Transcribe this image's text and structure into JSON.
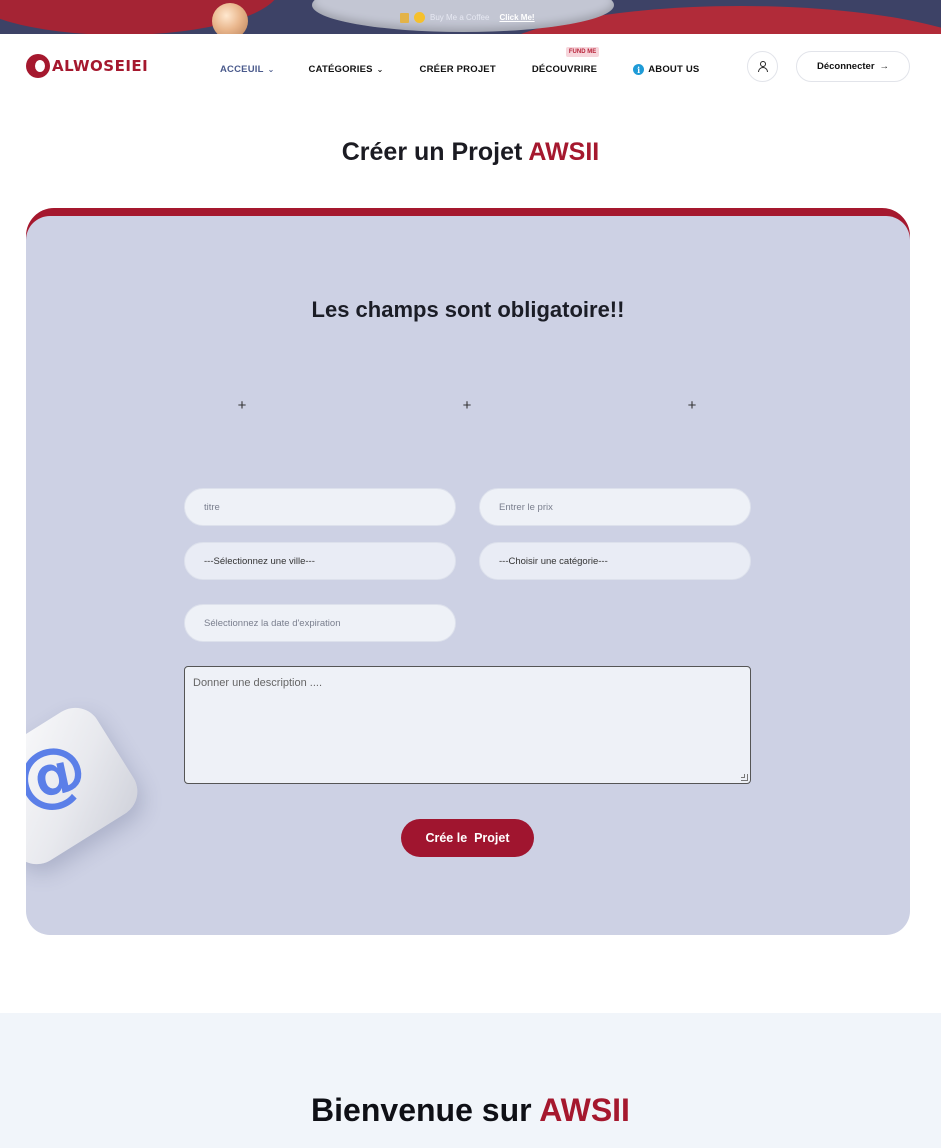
{
  "promo": {
    "text": "Buy Me a Coffee",
    "link": "Click Me!"
  },
  "brand": {
    "logo_text": "ALWOSEIEI"
  },
  "nav": {
    "items": [
      {
        "label": "ACCEUIL",
        "dropdown": true,
        "active": true
      },
      {
        "label": "CATÉGORIES",
        "dropdown": true
      },
      {
        "label": "CRÉER PROJET"
      },
      {
        "label": "DÉCOUVRIRE",
        "badge": "FUND ME"
      },
      {
        "label": "ABOUT US",
        "icon": "info-icon"
      }
    ],
    "user_icon": "user-icon",
    "logout_label": "Déconnecter"
  },
  "page": {
    "title_prefix": "Créer un Projet",
    "title_accent": "AWSII"
  },
  "form": {
    "heading": "Les champs sont obligatoire!!",
    "image_slots": [
      "+",
      "+",
      "+"
    ],
    "title_placeholder": "titre",
    "price_placeholder": "Entrer le prix",
    "city_select": "---Sélectionnez une ville---",
    "category_select": "---Choisir une catégorie---",
    "date_placeholder": "Sélectionnez la date d'expiration",
    "description_placeholder": "Donner une description ....",
    "submit_label": "Crée le  Projet"
  },
  "footer_section": {
    "title_prefix": "Bienvenue sur",
    "title_accent": "AWSII"
  },
  "colors": {
    "accent": "#a5182e",
    "card_bg": "#cdd1e4",
    "promo_bg": "#3d4266",
    "nav_active": "#4a5a8c"
  }
}
